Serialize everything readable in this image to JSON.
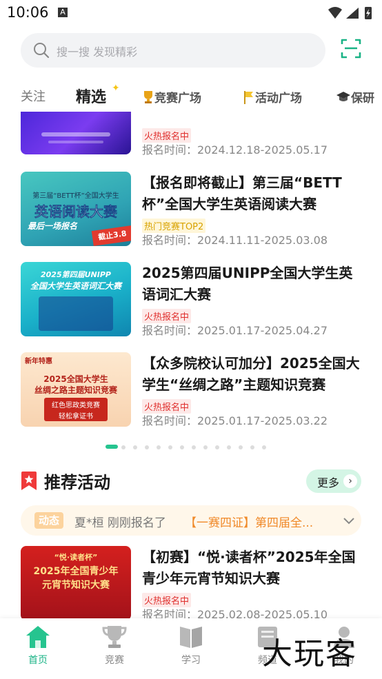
{
  "status_bar": {
    "time": "10:06",
    "a_icon": "A"
  },
  "search": {
    "placeholder": "搜一搜 发现精彩"
  },
  "tabs": [
    {
      "label": "关注"
    },
    {
      "label": "精选"
    },
    {
      "label": "竞赛广场"
    },
    {
      "label": "活动广场"
    },
    {
      "label": "保研"
    }
  ],
  "feed": [
    {
      "badge": "火热报名中",
      "time": "报名时间：2024.12.18-2025.05.17"
    },
    {
      "title": "【报名即将截止】第三届“BETT杯”全国大学生英语阅读大赛",
      "badge": "热门竞赛TOP2",
      "time": "报名时间：2024.11.11-2025.03.08",
      "thumb": {
        "line1": "第三届“BETT杯”全国大学生",
        "line2": "英语阅读大赛",
        "line3": "最后一场报名",
        "tag": "截止3.8"
      }
    },
    {
      "title": "2025第四届UNIPP全国大学生英语词汇大赛",
      "badge": "火热报名中",
      "time": "报名时间：2025.01.17-2025.04.27",
      "thumb": {
        "line1": "2025第四届UNIPP",
        "line2": "全国大学生英语词汇大赛"
      }
    },
    {
      "title": "【众多院校认可加分】2025全国大学生“丝绸之路”主题知识竞赛",
      "badge": "火热报名中",
      "time": "报名时间：2025.01.17-2025.03.22",
      "thumb": {
        "line0": "新年特惠",
        "line1": "2025全国大学生",
        "line2": "丝绸之路主题知识竞赛",
        "line3": "红色思政类竞赛",
        "line4": "轻松拿证书"
      }
    }
  ],
  "recommended": {
    "title": "推荐活动",
    "more_label": "更多",
    "ticker": {
      "tag": "动态",
      "user_text": "夏*桓 刚刚报名了",
      "event_text": "【一赛四证】第四届全..."
    },
    "item": {
      "title": "【初赛】“悦·读者杯”2025年全国青少年元宵节知识大赛",
      "badge": "火热报名中",
      "time": "报名时间：2025.02.08-2025.05.10",
      "thumb": {
        "line1": "“悦·读者杯”",
        "line2": "2025年全国青少年",
        "line3": "元宵节知识大赛"
      }
    }
  },
  "bottom_nav": [
    {
      "label": "首页",
      "icon": "home-icon"
    },
    {
      "label": "竞赛",
      "icon": "trophy-icon"
    },
    {
      "label": "学习",
      "icon": "book-icon"
    },
    {
      "label": "频道",
      "icon": "channel-icon"
    },
    {
      "label": "我的",
      "icon": "profile-icon"
    }
  ],
  "watermark": "大玩客",
  "colors": {
    "accent": "#26c48f",
    "hot": "#e0302e",
    "top": "#d8a200"
  }
}
